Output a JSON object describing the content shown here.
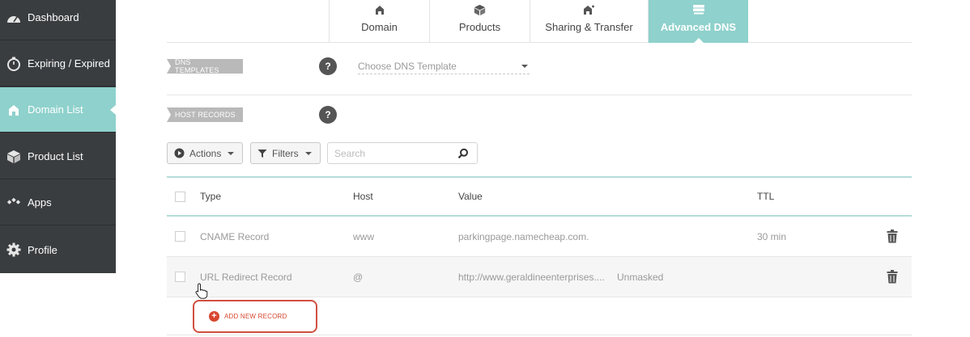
{
  "sidebar": {
    "items": [
      {
        "label": "Dashboard",
        "icon": "speedometer-icon"
      },
      {
        "label": "Expiring / Expired",
        "icon": "stopwatch-icon"
      },
      {
        "label": "Domain List",
        "icon": "house-icon",
        "active": true
      },
      {
        "label": "Product List",
        "icon": "box-icon"
      },
      {
        "label": "Apps",
        "icon": "apps-icon"
      },
      {
        "label": "Profile",
        "icon": "gear-icon"
      }
    ]
  },
  "tabs": [
    {
      "label": "Domain",
      "icon": "house-icon"
    },
    {
      "label": "Products",
      "icon": "box-icon"
    },
    {
      "label": "Sharing & Transfer",
      "icon": "share-icon"
    },
    {
      "label": "Advanced DNS",
      "icon": "server-icon",
      "active": true
    }
  ],
  "dns_templates": {
    "label": "DNS TEMPLATES",
    "help": "?",
    "select_placeholder": "Choose DNS Template"
  },
  "host_records": {
    "label": "HOST RECORDS",
    "help": "?"
  },
  "toolbar": {
    "actions_label": "Actions",
    "filters_label": "Filters",
    "search_placeholder": "Search"
  },
  "table": {
    "columns": [
      "Type",
      "Host",
      "Value",
      "TTL"
    ],
    "rows": [
      {
        "type": "CNAME Record",
        "host": "www",
        "value": "parkingpage.namecheap.com.",
        "extra": "",
        "ttl": "30 min"
      },
      {
        "type": "URL Redirect Record",
        "host": "@",
        "value": "http://www.geraldineenterprises....",
        "extra": "Unmasked",
        "ttl": ""
      }
    ]
  },
  "add_record": {
    "label": "ADD NEW RECORD",
    "icon_glyph": "+"
  },
  "colors": {
    "sidebar_bg": "#3a3d40",
    "accent_teal": "#8fd1cc",
    "add_red": "#d9462f"
  }
}
